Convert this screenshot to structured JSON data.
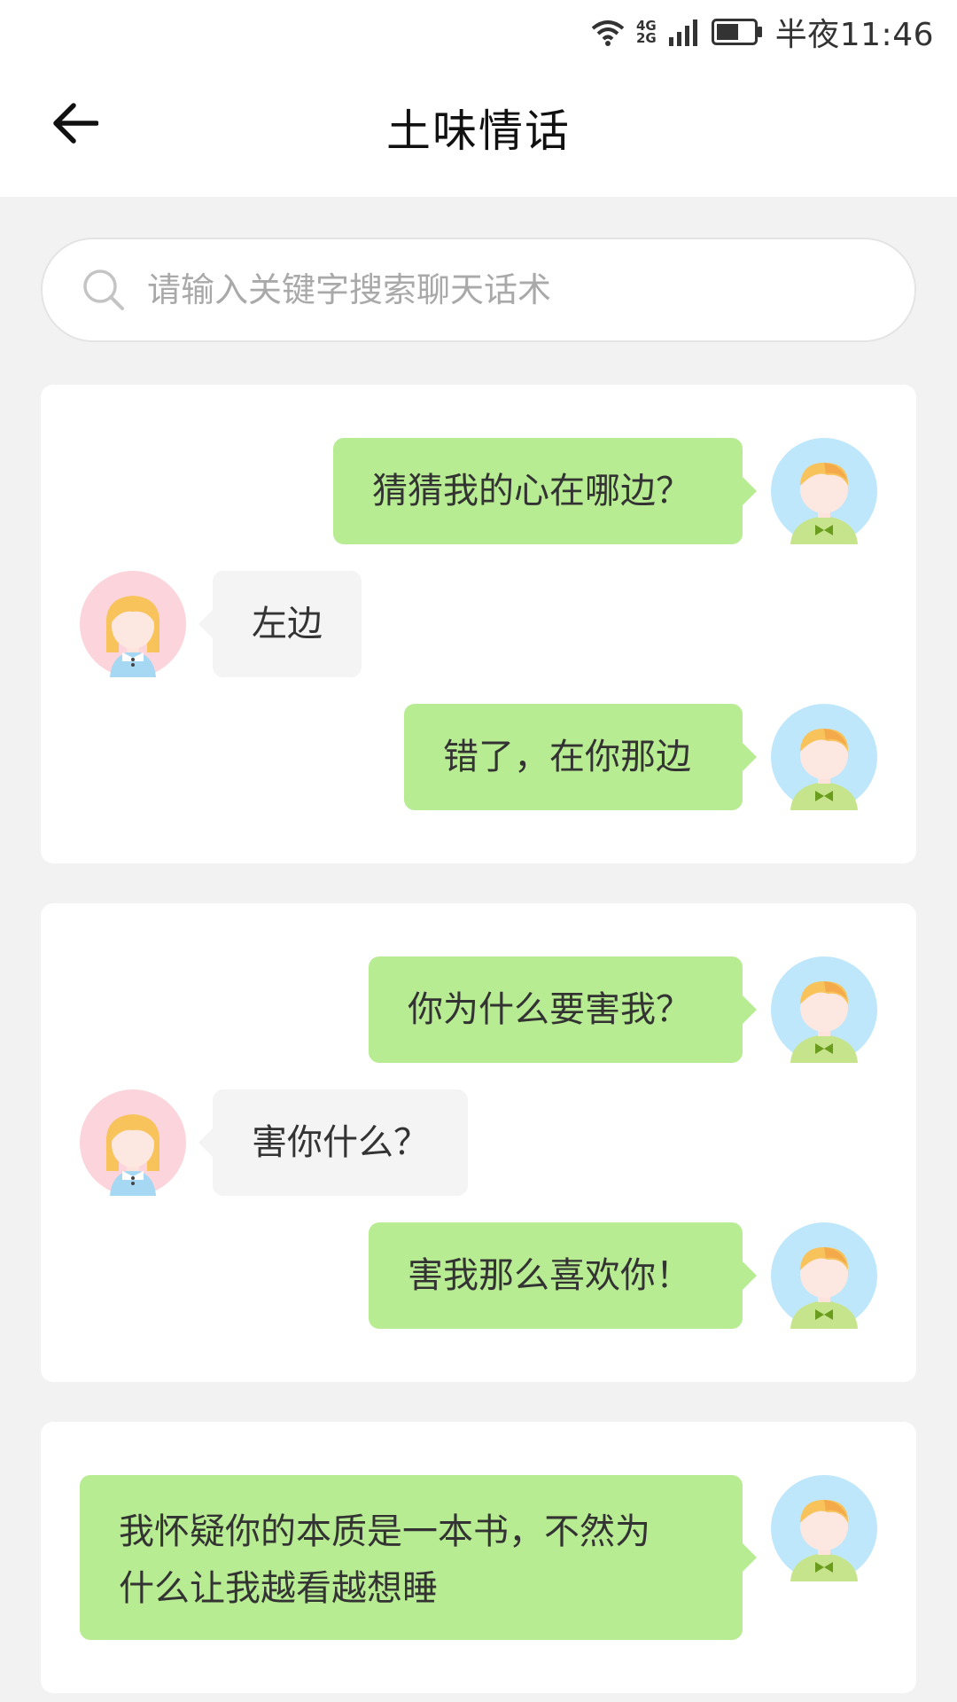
{
  "status_bar": {
    "network_top": "4G",
    "network_bottom": "2G",
    "time": "半夜11:46"
  },
  "header": {
    "title": "土味情话",
    "back_icon": "arrow-left-icon"
  },
  "search": {
    "placeholder": "请输入关键字搜索聊天话术",
    "value": ""
  },
  "colors": {
    "my_bubble": "#b8ec92",
    "her_bubble": "#f4f4f4",
    "background": "#f2f2f2"
  },
  "conversations": [
    {
      "messages": [
        {
          "from": "me",
          "text": "猜猜我的心在哪边？"
        },
        {
          "from": "her",
          "text": "左边"
        },
        {
          "from": "me",
          "text": "错了，在你那边"
        }
      ]
    },
    {
      "messages": [
        {
          "from": "me",
          "text": "你为什么要害我？"
        },
        {
          "from": "her",
          "text": "害你什么？"
        },
        {
          "from": "me",
          "text": "害我那么喜欢你！"
        }
      ]
    },
    {
      "messages": [
        {
          "from": "me",
          "lines": [
            "我怀疑你的本质是一本书，不然为",
            "什么让我越看越想睡"
          ]
        }
      ]
    }
  ]
}
